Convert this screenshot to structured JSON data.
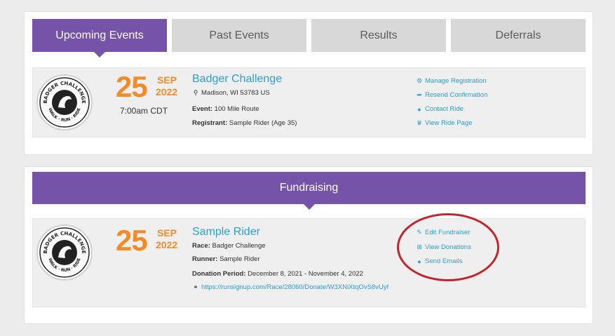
{
  "tabs": [
    {
      "label": "Upcoming Events"
    },
    {
      "label": "Past Events"
    },
    {
      "label": "Results"
    },
    {
      "label": "Deferrals"
    }
  ],
  "event": {
    "day": "25",
    "month": "SEP",
    "year": "2022",
    "time": "7:00am CDT",
    "title": "Badger Challenge",
    "location": "Madison, WI 53783 US",
    "event_label": "Event:",
    "event_value": "100 Mile Route",
    "registrant_label": "Registrant:",
    "registrant_value": "Sample Rider (Age 35)",
    "actions": [
      {
        "label": "Manage Registration",
        "icon": "gear-icon"
      },
      {
        "label": "Resend Confirmation",
        "icon": "share-icon"
      },
      {
        "label": "Contact Ride",
        "icon": "message-icon"
      },
      {
        "label": "View Ride Page",
        "icon": "trophy-icon"
      }
    ]
  },
  "fundraising": {
    "banner": "Fundraising",
    "day": "25",
    "month": "SEP",
    "year": "2022",
    "title": "Sample Rider",
    "race_label": "Race:",
    "race_value": "Badger Challenge",
    "runner_label": "Runner:",
    "runner_value": "Sample Rider",
    "period_label": "Donation Period:",
    "period_value": "December 8, 2021 - November 4, 2022",
    "url": "https://runsignup.com/Race/28060/Donate/W3XNiXtqOvS8vUyf",
    "actions": [
      {
        "label": "Edit Fundraiser",
        "icon": "edit-icon"
      },
      {
        "label": "View Donations",
        "icon": "gift-icon"
      },
      {
        "label": "Send Emails",
        "icon": "mail-icon"
      }
    ]
  },
  "logo_text": {
    "top": "BADGER CHALLENGE",
    "bottom": "WALK · RUN · RIDE"
  },
  "colors": {
    "accent": "#7553a8",
    "date": "#f28c28",
    "link": "#2a9fd6",
    "highlight": "#c0262d"
  }
}
